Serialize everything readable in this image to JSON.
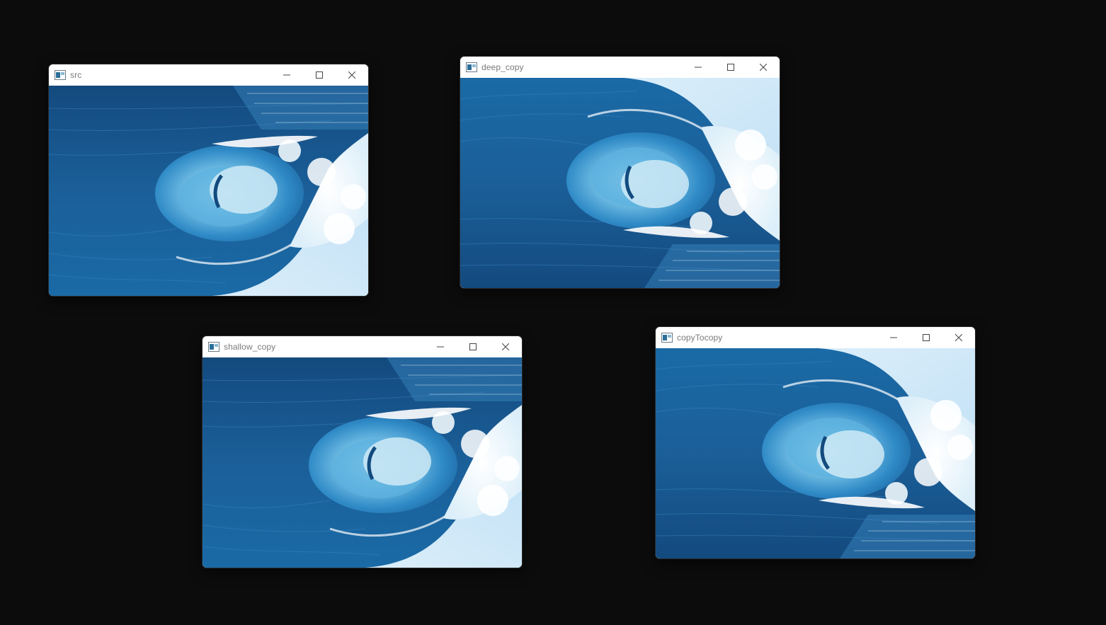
{
  "desktop": {
    "background": "#0c0c0c"
  },
  "windows": [
    {
      "title": "src",
      "image": "ocean-wave-tube",
      "flipped": true
    },
    {
      "title": "deep_copy",
      "image": "ocean-wave-tube",
      "flipped": false
    },
    {
      "title": "shallow_copy",
      "image": "ocean-wave-tube",
      "flipped": true
    },
    {
      "title": "copyTocopy",
      "image": "ocean-wave-tube",
      "flipped": false
    }
  ],
  "controls": [
    "minimize-icon",
    "maximize-icon",
    "close-icon"
  ],
  "colors": {
    "deep_sea": "#0f4f86",
    "mid_sea": "#2a7bb8",
    "tube": "#6fc0e6",
    "foam": "#f4f9fd",
    "sky": "#cfe6f7"
  }
}
